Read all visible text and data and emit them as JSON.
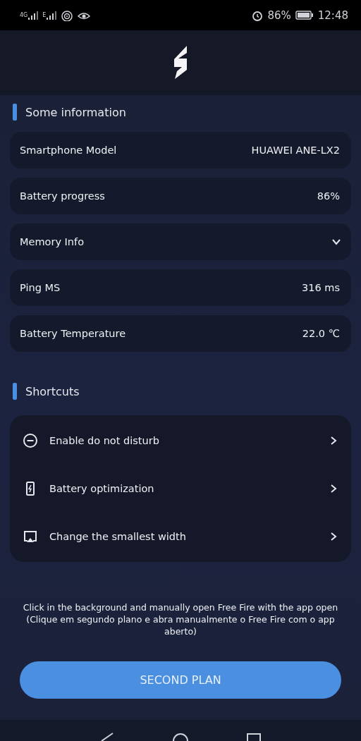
{
  "status_bar": {
    "networks": [
      "4G",
      "E"
    ],
    "battery": "86%",
    "time": "12:48"
  },
  "sections": [
    {
      "title": "Some information",
      "kind": "info",
      "rows": [
        {
          "kind": "value",
          "label": "Smartphone Model",
          "value": "HUAWEI ANE-LX2"
        },
        {
          "kind": "value",
          "label": "Battery progress",
          "value": "86%"
        },
        {
          "kind": "expandable",
          "label": "Memory Info",
          "expanded": false
        },
        {
          "kind": "value",
          "label": "Ping MS",
          "value": "316 ms"
        },
        {
          "kind": "value",
          "label": "Battery Temperature",
          "value": "22.0 ℃"
        }
      ]
    },
    {
      "title": "Shortcuts",
      "kind": "shortcuts",
      "rows": [
        {
          "kind": "minus-circle",
          "label": "Enable do not disturb"
        },
        {
          "kind": "battery",
          "label": "Battery optimization"
        },
        {
          "kind": "screen",
          "label": "Change the smallest width"
        }
      ]
    }
  ],
  "note": "Click in the background and manually open Free Fire with the app open (Clique em segundo plano e abra manualmente o Free Fire com o app aberto)",
  "button": "SECOND PLAN"
}
